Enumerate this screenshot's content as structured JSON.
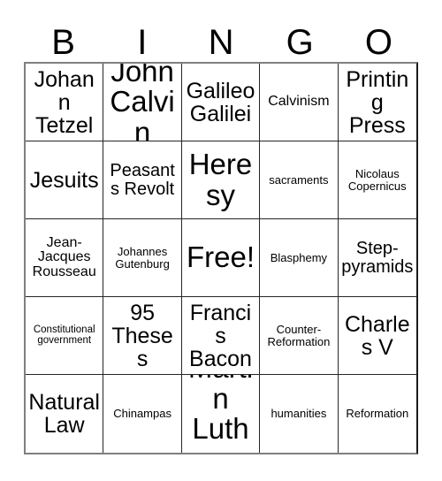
{
  "card": {
    "type": "bingo-card",
    "columns": 5,
    "rows": 5,
    "background_color": "#ffffff",
    "text_color": "#000000",
    "border_color": "#262626",
    "outer_border_color": "#808080"
  },
  "header": {
    "letters": [
      "B",
      "I",
      "N",
      "G",
      "O"
    ]
  },
  "grid": {
    "cells": [
      {
        "text": "Johann Tetzel",
        "size": "lg",
        "free": false
      },
      {
        "text": "John Calvin",
        "size": "xl",
        "free": false
      },
      {
        "text": "Galileo Galilei",
        "size": "lg",
        "free": false
      },
      {
        "text": "Calvinism",
        "size": "sm",
        "free": false
      },
      {
        "text": "Printing Press",
        "size": "lg",
        "free": false
      },
      {
        "text": "Jesuits",
        "size": "lg",
        "free": false
      },
      {
        "text": "Peasants Revolt",
        "size": "md",
        "free": false
      },
      {
        "text": "Heresy",
        "size": "xl",
        "free": false
      },
      {
        "text": "sacraments",
        "size": "xs",
        "free": false
      },
      {
        "text": "Nicolaus Copernicus",
        "size": "xs",
        "free": false
      },
      {
        "text": "Jean-Jacques Rousseau",
        "size": "sm",
        "free": false
      },
      {
        "text": "Johannes Gutenburg",
        "size": "xs",
        "free": false
      },
      {
        "text": "Free!",
        "size": "xl",
        "free": true
      },
      {
        "text": "Blasphemy",
        "size": "xs",
        "free": false
      },
      {
        "text": "Step-pyramids",
        "size": "md",
        "free": false
      },
      {
        "text": "Constitutional government",
        "size": "xxs",
        "free": false
      },
      {
        "text": "95 Theses",
        "size": "lg",
        "free": false
      },
      {
        "text": "Francis Bacon",
        "size": "lg",
        "free": false
      },
      {
        "text": "Counter-Reformation",
        "size": "xs",
        "free": false
      },
      {
        "text": "Charles V",
        "size": "lg",
        "free": false
      },
      {
        "text": "Natural Law",
        "size": "lg",
        "free": false
      },
      {
        "text": "Chinampas",
        "size": "xs",
        "free": false
      },
      {
        "text": "Martin Luther",
        "size": "xl",
        "free": false
      },
      {
        "text": "humanities",
        "size": "xs",
        "free": false
      },
      {
        "text": "Reformation",
        "size": "xs",
        "free": false
      }
    ]
  }
}
